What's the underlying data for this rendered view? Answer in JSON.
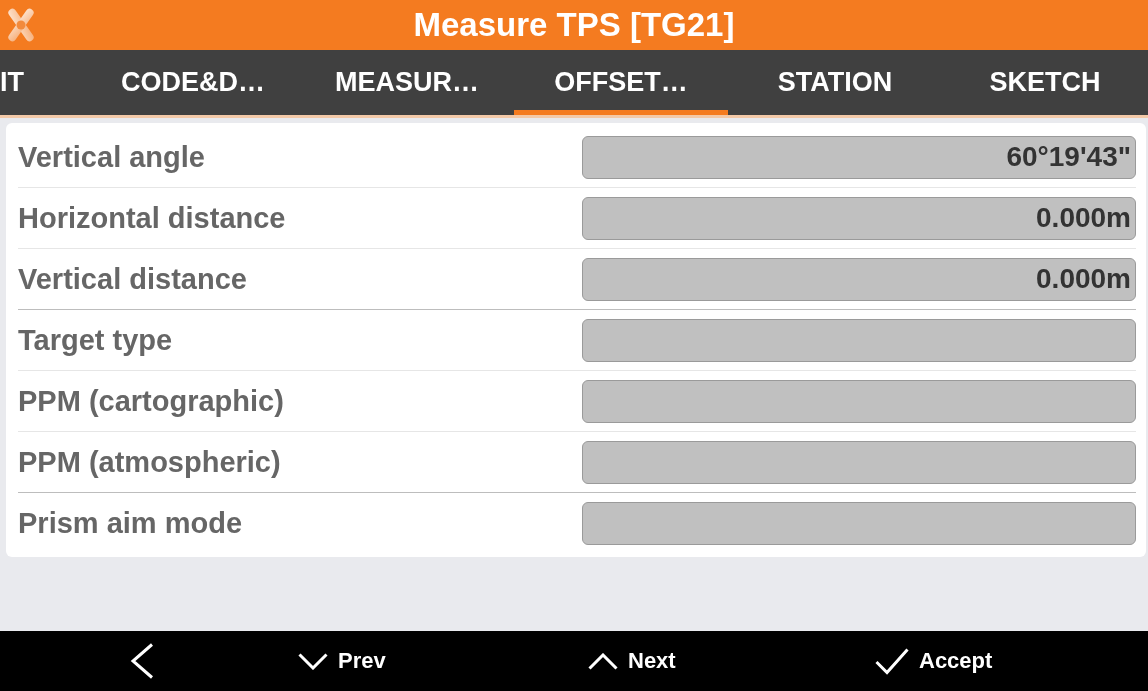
{
  "window": {
    "title": "Measure TPS [TG21]"
  },
  "tabs": [
    {
      "label": "IT",
      "selected": false
    },
    {
      "label": "CODE&D…",
      "selected": false
    },
    {
      "label": "MEASUR…",
      "selected": false
    },
    {
      "label": "OFFSET…",
      "selected": true
    },
    {
      "label": "STATION",
      "selected": false
    },
    {
      "label": "SKETCH",
      "selected": false
    }
  ],
  "groups": [
    {
      "rows": [
        {
          "label": "Vertical angle",
          "value": "60°19'43\""
        },
        {
          "label": "Horizontal distance",
          "value": "0.000m"
        },
        {
          "label": "Vertical distance",
          "value": "0.000m"
        }
      ]
    },
    {
      "rows": [
        {
          "label": "Target type"
        },
        {
          "label": "PPM (cartographic)"
        },
        {
          "label": "PPM (atmospheric)"
        }
      ]
    },
    {
      "rows": [
        {
          "label": "Prism aim mode"
        }
      ]
    }
  ],
  "bottom_bar": {
    "buttons": [
      {
        "label": "Prev"
      },
      {
        "label": "Next"
      },
      {
        "label": "Accept"
      }
    ]
  }
}
